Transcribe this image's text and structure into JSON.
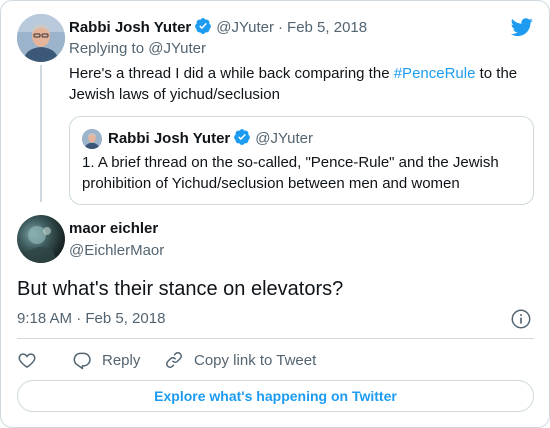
{
  "parent_tweet": {
    "author_name": "Rabbi Josh Yuter",
    "author_handle": "@JYuter",
    "date": "Feb 5, 2018",
    "separator": "·",
    "replying_to_prefix": "Replying to",
    "replying_to_handle": "@JYuter",
    "text_before": "Here's a thread I did a while back comparing the ",
    "hashtag": "#PenceRule",
    "text_after": " to the Jewish laws of yichud/seclusion"
  },
  "quoted_tweet": {
    "author_name": "Rabbi Josh Yuter",
    "author_handle": "@JYuter",
    "text": "1. A brief thread on the so-called, \"Pence-Rule\" and the Jewish prohibition of Yichud/seclusion between men and women"
  },
  "main_tweet": {
    "author_name": "maor eichler",
    "author_handle": "@EichlerMaor",
    "text": "But what's their stance on elevators?",
    "timestamp": "9:18 AM · Feb 5, 2018"
  },
  "actions": {
    "reply_label": "Reply",
    "copy_link_label": "Copy link to Tweet"
  },
  "footer": {
    "explore_label": "Explore what's happening on Twitter"
  },
  "colors": {
    "accent": "#1d9bf0",
    "text_primary": "#0f1419",
    "text_secondary": "#536471",
    "border": "#cfd9de"
  },
  "icons": [
    "twitter-bird-icon",
    "verified-badge-icon",
    "info-icon",
    "heart-icon",
    "reply-icon",
    "link-icon"
  ]
}
